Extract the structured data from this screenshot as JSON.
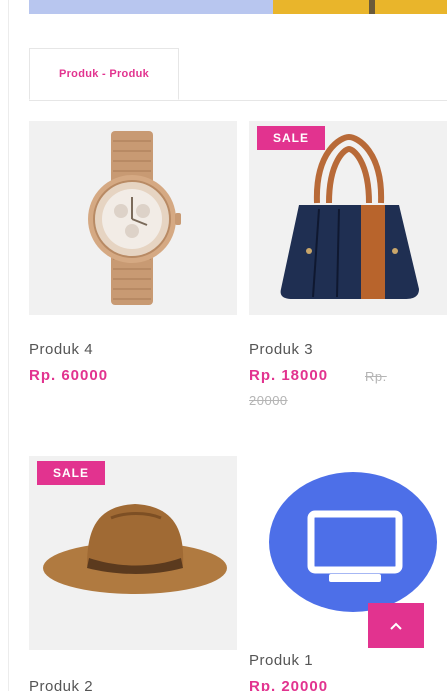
{
  "tabs": [
    {
      "label": "Produk - Produk",
      "active": true
    }
  ],
  "products": [
    {
      "name": "Produk 4",
      "price": "Rp. 60000",
      "sale": false,
      "image": "watch"
    },
    {
      "name": "Produk 3",
      "price": "Rp. 18000",
      "old_price": "Rp. 20000",
      "old_price_line1": "Rp.",
      "old_price_line2": "20000",
      "sale": true,
      "sale_label": "SALE",
      "image": "handbag"
    },
    {
      "name": "Produk 2",
      "sale": true,
      "sale_label": "SALE",
      "image": "hat"
    },
    {
      "name": "Produk 1",
      "price": "Rp. 20000",
      "sale": false,
      "image": "monitor-icon"
    }
  ],
  "scroll_top": {
    "icon": "chevron-up-icon"
  },
  "colors": {
    "accent": "#e2338f",
    "thumb_bg": "#f1f1f1",
    "monitor_circle": "#4d6fe8",
    "banner_blue": "#b8c6ef",
    "banner_yellow": "#e9b52b"
  }
}
